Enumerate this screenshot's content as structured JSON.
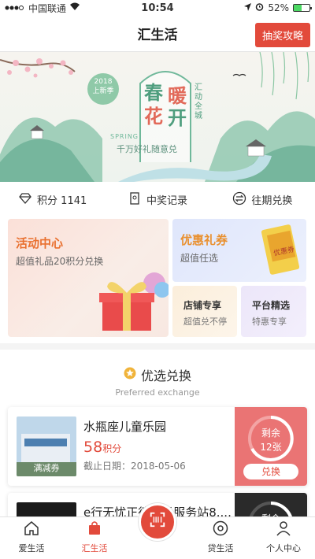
{
  "status_bar": {
    "carrier": "中国联通",
    "time": "10:54",
    "battery": "52%",
    "battery_level": 0.52
  },
  "header": {
    "title": "汇生活",
    "lottery_button": "抽奖攻略"
  },
  "banner": {
    "badge_year": "2018",
    "badge_season": "上新季",
    "headline": [
      "春",
      "暖",
      "花",
      "开"
    ],
    "side_text": "汇动全城",
    "spring": "SPRING",
    "slogan": "千万好礼随意兑"
  },
  "stats": {
    "points_label": "积分 1141",
    "records_label": "中奖记录",
    "history_label": "往期兑换"
  },
  "features": {
    "activity": {
      "title": "活动中心",
      "subtitle": "超值礼品20积分兑换"
    },
    "coupon": {
      "title": "优惠礼券",
      "subtitle": "超值任选",
      "ticket_text": "优惠券"
    },
    "shop": {
      "title": "店铺专享",
      "subtitle": "超值兑不停"
    },
    "platform": {
      "title": "平台精选",
      "subtitle": "特惠专享"
    }
  },
  "preferred": {
    "title": "优选兑换",
    "subtitle": "Preferred exchange",
    "items": [
      {
        "name": "水瓶座儿童乐园",
        "points": "58",
        "points_unit": "积分",
        "date": "截止日期：2018-05-06",
        "thumb_label": "满减券",
        "remain_label": "剩余",
        "remain_count": "12张",
        "exchange_button": "兑换"
      },
      {
        "name": "e行无忧正德广场服务站8....",
        "remain_label": "剩余"
      }
    ]
  },
  "tabbar": {
    "tabs": [
      {
        "label": "爱生活"
      },
      {
        "label": "汇生活"
      },
      {
        "label": ""
      },
      {
        "label": "贷生活"
      },
      {
        "label": "个人中心"
      }
    ]
  },
  "colors": {
    "accent": "#e24a3b",
    "orange": "#e9702f",
    "banner_green": "#5aa58a"
  }
}
